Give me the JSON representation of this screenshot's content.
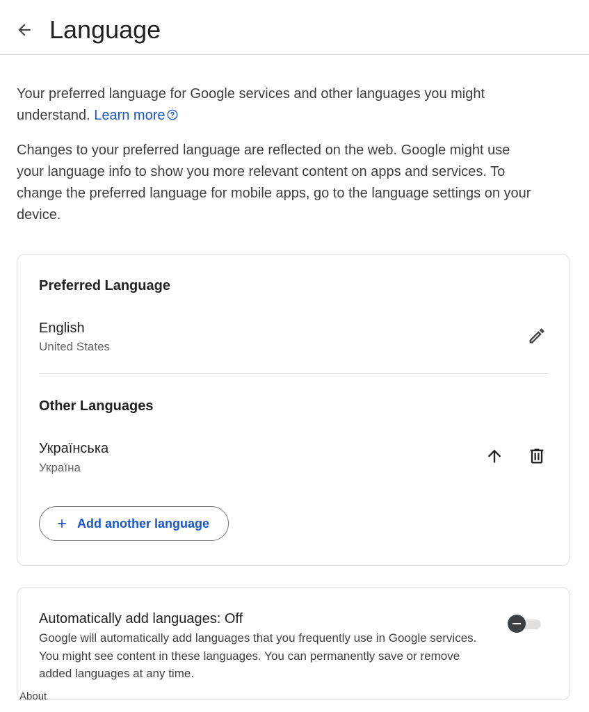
{
  "header": {
    "title": "Language"
  },
  "intro": {
    "text1": "Your preferred language for Google services and other languages you might understand.",
    "learn_more": "Learn more",
    "text2": "Changes to your preferred language are reflected on the web. Google might use your language info to show you more relevant content on apps and services. To change the preferred language for mobile apps, go to the language settings on your device."
  },
  "preferred": {
    "title": "Preferred Language",
    "language": "English",
    "region": "United States"
  },
  "other": {
    "title": "Other Languages",
    "language": "Українська",
    "region": "Україна",
    "add_label": "Add another language"
  },
  "auto": {
    "title": "Automatically add languages: Off",
    "description": "Google will automatically add languages that you frequently use in Google services. You might see content in these languages. You can permanently save or remove added languages at any time.",
    "enabled": false
  },
  "footer": {
    "about": "About"
  },
  "colors": {
    "accent": "#1a56c9",
    "border": "#dadce0",
    "text": "#202124"
  },
  "icons": [
    "back-arrow-icon",
    "help-circle-icon",
    "pencil-icon",
    "arrow-up-icon",
    "trash-icon",
    "plus-icon"
  ]
}
